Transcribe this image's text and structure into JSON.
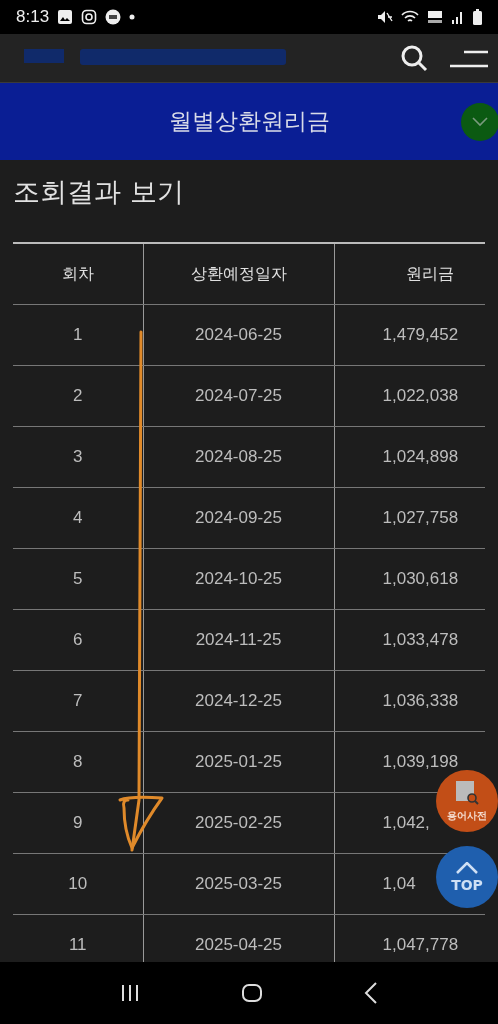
{
  "status_bar": {
    "time": "8:13"
  },
  "title_bar": {
    "title": "월별상환원리금"
  },
  "section_title": "조회결과 보기",
  "table": {
    "columns": [
      "회차",
      "상환예정일자",
      "원리금"
    ],
    "rows": [
      [
        "1",
        "2024-06-25",
        "1,479,452"
      ],
      [
        "2",
        "2024-07-25",
        "1,022,038"
      ],
      [
        "3",
        "2024-08-25",
        "1,024,898"
      ],
      [
        "4",
        "2024-09-25",
        "1,027,758"
      ],
      [
        "5",
        "2024-10-25",
        "1,030,618"
      ],
      [
        "6",
        "2024-11-25",
        "1,033,478"
      ],
      [
        "7",
        "2024-12-25",
        "1,036,338"
      ],
      [
        "8",
        "2025-01-25",
        "1,039,198"
      ],
      [
        "9",
        "2025-02-25",
        "1,042,"
      ],
      [
        "10",
        "2025-03-25",
        "1,04"
      ],
      [
        "11",
        "2025-04-25",
        "1,047,778"
      ]
    ]
  },
  "float_buttons": [
    {
      "kind": "glossary",
      "label": "용어사전"
    },
    {
      "kind": "top",
      "label": "TOP"
    }
  ]
}
